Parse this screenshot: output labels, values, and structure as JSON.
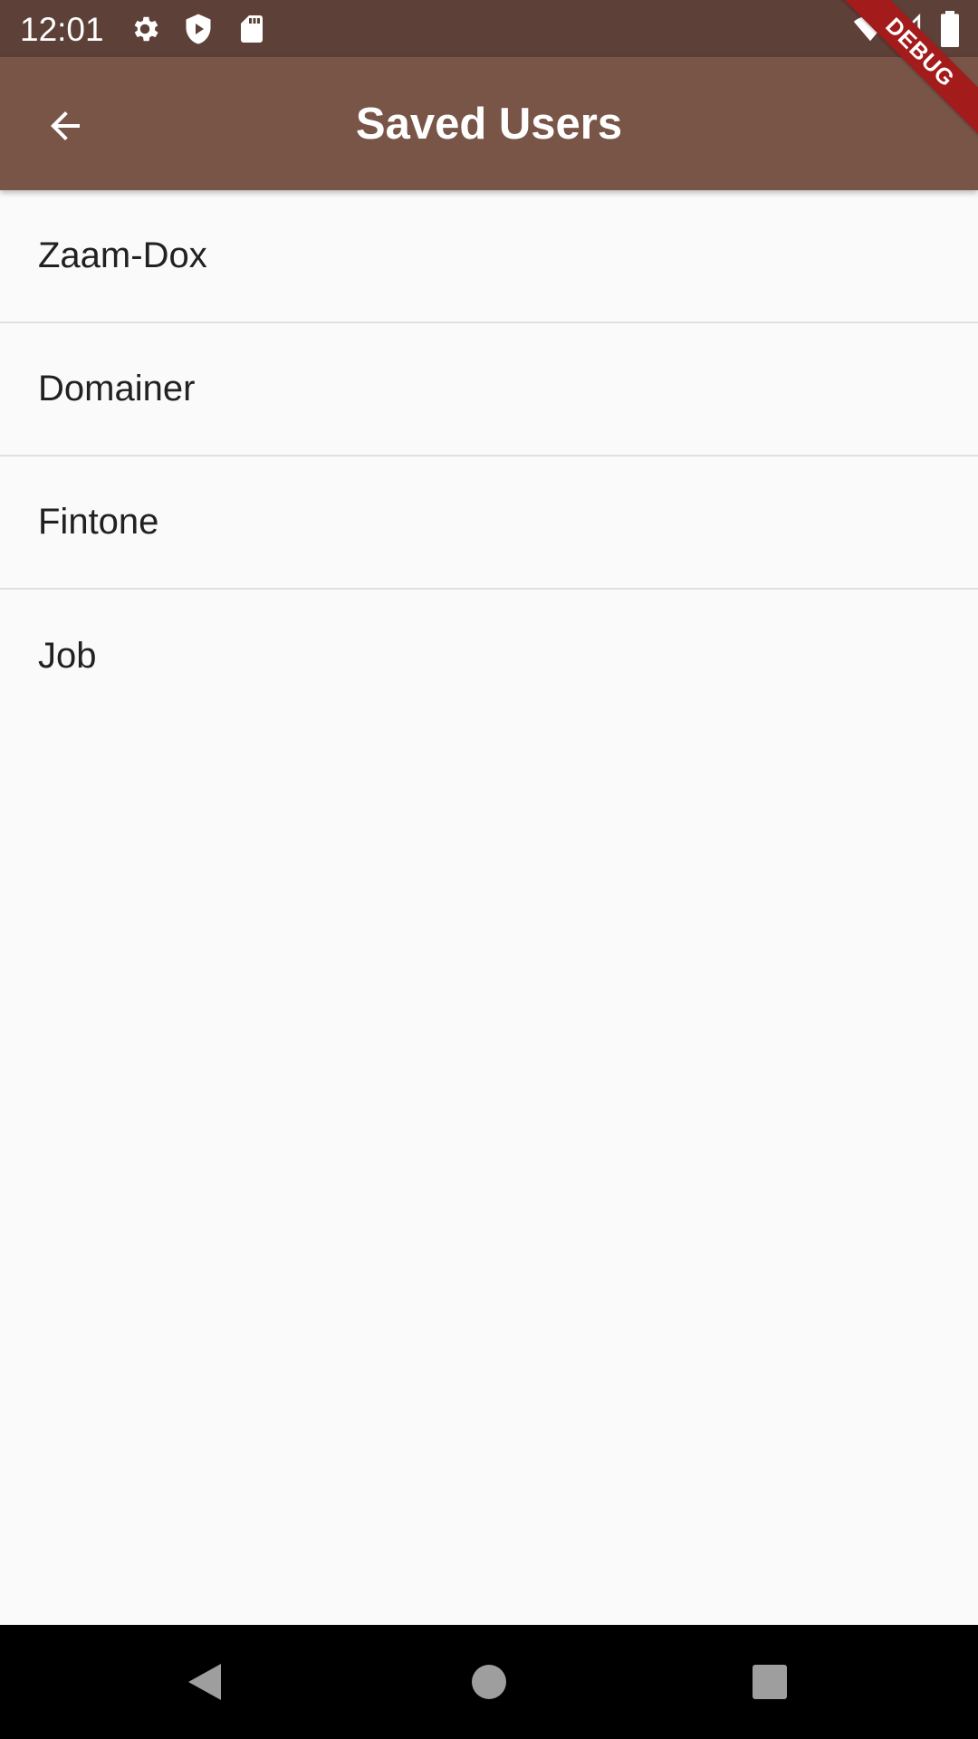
{
  "status_bar": {
    "time": "12:01",
    "icons": [
      "gear-icon",
      "shield-icon",
      "sd-card-icon",
      "wifi-icon",
      "signal-icon",
      "battery-icon"
    ]
  },
  "app_bar": {
    "title": "Saved Users",
    "back_icon": "arrow-back-icon"
  },
  "debug_banner": "DEBUG",
  "users": [
    {
      "name": "Zaam-Dox"
    },
    {
      "name": "Domainer"
    },
    {
      "name": "Fintone"
    },
    {
      "name": "Job"
    }
  ],
  "nav_bar": {
    "icons": [
      "nav-back-icon",
      "nav-home-icon",
      "nav-recents-icon"
    ]
  },
  "colors": {
    "status_bar": "#5d4037",
    "app_bar": "#795548",
    "debug_ribbon": "#a31b1b",
    "background": "#fafafa"
  }
}
